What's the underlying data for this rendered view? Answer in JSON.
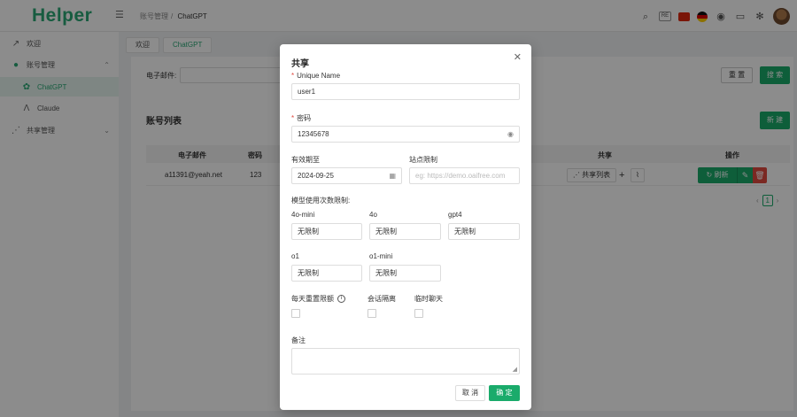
{
  "app": {
    "title": "Helper"
  },
  "breadcrumb": {
    "parent": "账号管理",
    "current": "ChatGPT"
  },
  "header": {
    "language": "RE"
  },
  "sidebar": {
    "items": [
      {
        "label": "欢迎",
        "icon": "chart-icon"
      },
      {
        "label": "账号管理",
        "icon": "user-icon"
      },
      {
        "label": "ChatGPT",
        "icon": "openai-icon"
      },
      {
        "label": "Claude",
        "icon": "claude-icon"
      },
      {
        "label": "共享管理",
        "icon": "share-icon"
      }
    ]
  },
  "tabs": [
    {
      "label": "欢迎"
    },
    {
      "label": "ChatGPT"
    }
  ],
  "search": {
    "label": "电子邮件:",
    "reset_label": "重 置",
    "search_label": "搜 索"
  },
  "list": {
    "title": "账号列表",
    "new_label": "新 建",
    "columns": {
      "email": "电子邮件",
      "password": "密码",
      "share": "共享",
      "actions": "操作"
    },
    "rows": [
      {
        "email": "a11391@yeah.net",
        "password": "123"
      }
    ],
    "share_list_label": "共享列表",
    "refresh_label": "刷新",
    "page": "1"
  },
  "modal": {
    "title": "共享",
    "unique_name": {
      "label": "Unique Name",
      "value": "user1"
    },
    "password": {
      "label": "密码",
      "value": "12345678"
    },
    "expiry": {
      "label": "有效期至",
      "value": "2024-09-25"
    },
    "site_limit": {
      "label": "站点限制",
      "placeholder": "eg: https://demo.oaifree.com"
    },
    "model_limit_label": "模型使用次数限制:",
    "models": [
      {
        "name": "4o-mini",
        "value": "无限制"
      },
      {
        "name": "4o",
        "value": "无限制"
      },
      {
        "name": "gpt4",
        "value": "无限制"
      },
      {
        "name": "o1",
        "value": "无限制"
      },
      {
        "name": "o1-mini",
        "value": "无限制"
      }
    ],
    "checks": [
      {
        "label": "每天重置限额"
      },
      {
        "label": "会话隔离"
      },
      {
        "label": "临时聊天"
      }
    ],
    "note": {
      "label": "备注"
    },
    "cancel_label": "取 消",
    "ok_label": "确 定"
  },
  "colors": {
    "brand": "#2aa876",
    "primary_button": "#1aab6b",
    "danger": "#e04a3f"
  }
}
